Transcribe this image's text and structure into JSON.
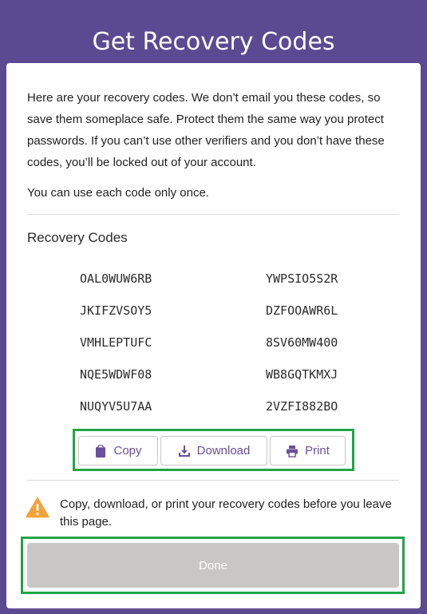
{
  "header": {
    "title": "Get Recovery Codes"
  },
  "intro": {
    "paragraph": "Here are your recovery codes. We don’t email you these codes, so save them someplace safe. Protect them the same way you protect passwords. If you can’t use other verifiers and you don’t have these codes, you’ll be locked out of your account.",
    "single_use_note": "You can use each code only once."
  },
  "recovery": {
    "title": "Recovery Codes",
    "codes": [
      "OAL0WUW6RB",
      "YWPSIO5S2R",
      "JKIFZVSOY5",
      "DZFOOAWR6L",
      "VMHLEPTUFC",
      "8SV60MW400",
      "NQE5WDWF08",
      "WB8GQTKMXJ",
      "NUQYV5U7AA",
      "2VZFI882BO"
    ]
  },
  "actions": {
    "copy": "Copy",
    "download": "Download",
    "print": "Print"
  },
  "warning": {
    "icon": "warning-icon",
    "text": "Copy, download, or print your recovery codes before you leave this page."
  },
  "done": {
    "label": "Done",
    "state": "disabled"
  },
  "colors": {
    "brand": "#5b4a92",
    "accent": "#6b4e9c",
    "highlight": "#22a447",
    "warning": "#f2a23a",
    "disabled": "#c9c7c5"
  }
}
